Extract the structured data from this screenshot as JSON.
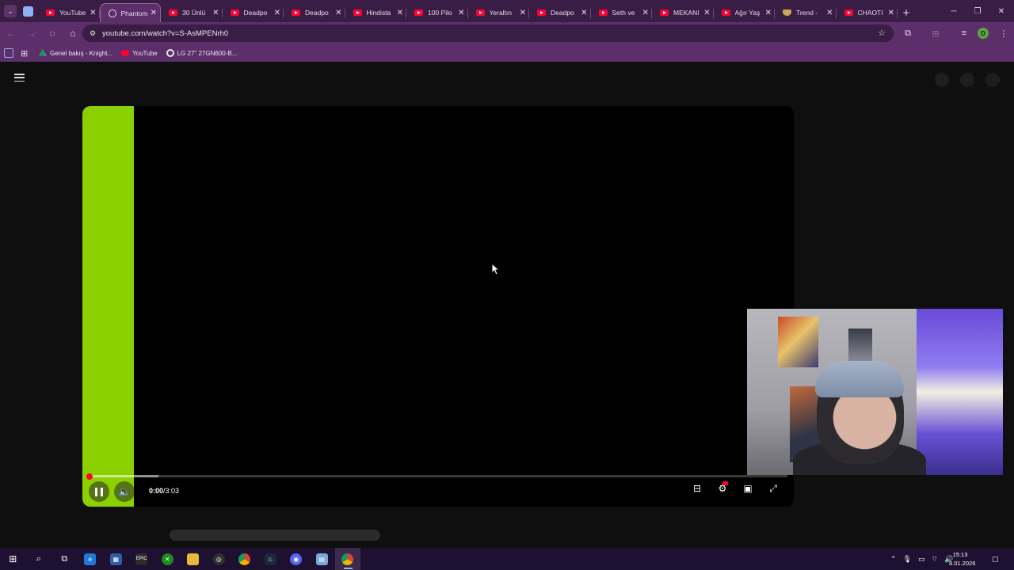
{
  "browser": {
    "tabs": [
      {
        "label": "YouTube",
        "active": false,
        "icon": "youtube-icon"
      },
      {
        "label": "Phantom",
        "active": true,
        "icon": "loading-icon"
      },
      {
        "label": "30 Ünlü",
        "active": false,
        "icon": "youtube-icon"
      },
      {
        "label": "Deadpo",
        "active": false,
        "icon": "youtube-icon"
      },
      {
        "label": "Deadpo",
        "active": false,
        "icon": "youtube-icon"
      },
      {
        "label": "Hindista",
        "active": false,
        "icon": "youtube-icon"
      },
      {
        "label": "100 Pilo",
        "active": false,
        "icon": "youtube-icon"
      },
      {
        "label": "Yeraltın",
        "active": false,
        "icon": "youtube-icon"
      },
      {
        "label": "Deadpo",
        "active": false,
        "icon": "youtube-icon"
      },
      {
        "label": "Seth ve",
        "active": false,
        "icon": "youtube-icon"
      },
      {
        "label": "MEKANI",
        "active": false,
        "icon": "youtube-icon"
      },
      {
        "label": "Ağır Yaş",
        "active": false,
        "icon": "youtube-icon"
      },
      {
        "label": "Trend -",
        "active": false,
        "icon": "trend-icon"
      },
      {
        "label": "CHAOTI",
        "active": false,
        "icon": "youtube-icon"
      }
    ],
    "url": "youtube.com/watch?v=S-AsMPENrh0",
    "profile_initial": "D",
    "bookmarks": [
      {
        "label": "Genel bakış - Knight...",
        "icon": "drive-icon"
      },
      {
        "label": "YouTube",
        "icon": "youtube-icon"
      },
      {
        "label": "LG 27\" 27GN600-B...",
        "icon": "google-icon"
      }
    ],
    "colors": {
      "frame": "#3a1d44",
      "toolbar": "#5c2e6a",
      "accent": "#8fb0f2"
    }
  },
  "player": {
    "time_current": "0:00",
    "time_separator": " / ",
    "time_total": "3:03",
    "progress_played": 0,
    "progress_buffered": 0.1,
    "state": "playing",
    "accent_color": "#8bd100",
    "scrubber_color": "#ff0033",
    "controls": [
      "pause-icon",
      "volume-icon",
      "subtitles-icon",
      "settings-icon",
      "theater-icon",
      "fullscreen-icon"
    ]
  },
  "taskbar": {
    "apps": [
      "start-icon",
      "search-icon",
      "task-view-icon",
      "edge-icon",
      "store-icon",
      "epic-games-icon",
      "xbox-icon",
      "file-explorer-icon",
      "obs-icon",
      "chrome-icon",
      "steam-icon",
      "discord-icon",
      "notepad-icon",
      "chrome-profile-icon"
    ],
    "clock_time": "15:13",
    "clock_date": "8.01.2026"
  }
}
